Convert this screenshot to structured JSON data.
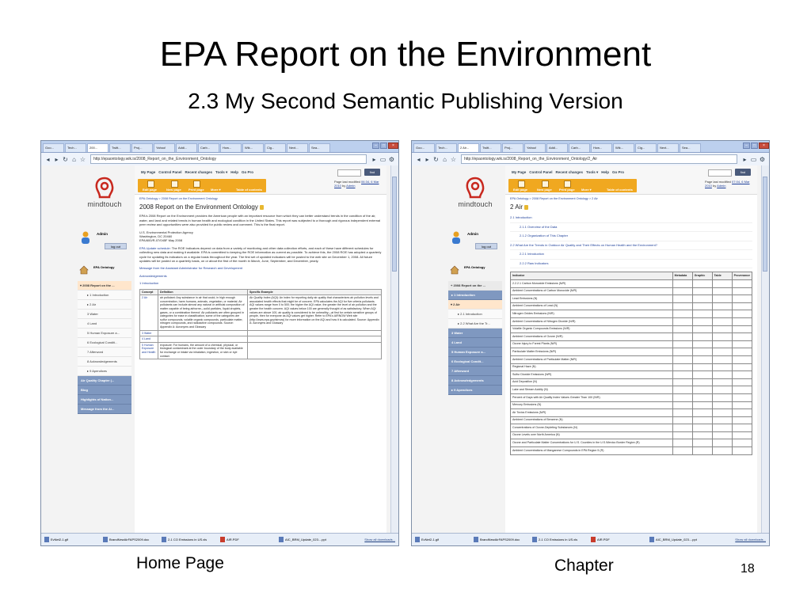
{
  "slide": {
    "title": "EPA Report on the Environment",
    "subtitle": "2.3 My Second Semantic Publishing Version",
    "caption_left": "Home Page",
    "caption_right": "Chapter",
    "page_number": "18"
  },
  "left_browser": {
    "tabs": [
      "Goo...",
      "Tech...",
      "200...",
      "Twitt...",
      "Proj...",
      "Yahoo!",
      "Addi...",
      "Carb...",
      "How...",
      "Wik...",
      "Cig...",
      "Next...",
      "Sea..."
    ],
    "active_tab": 2,
    "url": "http://epaontology.wik.is/2008_Report_on_the_Environment_Ontology",
    "window_buttons": [
      "–",
      "□",
      "×"
    ],
    "logo_text": "mindtouch",
    "user": "Admin",
    "logout": "log out",
    "nav_header": "EPA Ontology",
    "nav": [
      {
        "label": "▾ 2008 Report on the ...",
        "kind": "current"
      },
      {
        "label": "▸ 1 Introduction",
        "kind": "sub"
      },
      {
        "label": "▸ 2 Air",
        "kind": "sub"
      },
      {
        "label": "3 Water",
        "kind": "sub"
      },
      {
        "label": "4 Land",
        "kind": "sub"
      },
      {
        "label": "5 Human Exposure a...",
        "kind": "sub"
      },
      {
        "label": "6 Ecological Conditi...",
        "kind": "sub"
      },
      {
        "label": "7 Afterword",
        "kind": "sub"
      },
      {
        "label": "8 Acknowledgements",
        "kind": "sub"
      },
      {
        "label": "▸ 9 Apendices",
        "kind": "sub"
      },
      {
        "label": "Air Quality Chapter (...",
        "kind": "dark"
      },
      {
        "label": "Blog",
        "kind": "dark"
      },
      {
        "label": "Highlights of Nation...",
        "kind": "dark"
      },
      {
        "label": "Message from the Ai...",
        "kind": "dark"
      }
    ],
    "toplinks": [
      "My Page",
      "Control Panel",
      "Recent changes",
      "Tools ▾",
      "Help",
      "Go Pro"
    ],
    "find": "find",
    "editbar": [
      "Edit page",
      "New page",
      "Print page",
      "More ▾",
      "Table of contents"
    ],
    "lastmod_prefix": "Page last modified",
    "lastmod_date": "06:34, 6 Mar 2010",
    "lastmod_by": "by",
    "lastmod_user": "Admin",
    "breadcrumb": "EPA Ontology > 2008 Report on the Environment Ontology",
    "page_title": "2008 Report on the Environment Ontology",
    "intro": "EPA's 2008 Report on the Environment provides the American people with an important resource from which they can better understand trends in the condition of the air, water, and land and related trends in human health and ecological condition in the United States. This report was subjected to a thorough and rigorous independent external peer review and opportunities were also provided for public review and comment. This is the final report.",
    "address": "U.S. Environmental Protection Agency",
    "address2": "Washington, DC 20460",
    "address3": "EPA/600/R-07/045F May 2008",
    "update_link": "EPA Update schedule",
    "update_text": ": The ROE Indicators depend on data from a variety of monitoring and other data collection efforts, and each of these have different schedules for collecting new data and making it available. EPA is committed to keeping the ROE information as current as possible. To achieve this, the 2008 ROE has adopted a quarterly cycle for updating its indicators on a regular basis throughout the year. The first set of updated indicators will be posted to the web site on December 1, 2008. All future updates will be posted on a quarterly basis, on or about the first of the month in March, June, September, and December, yearly.",
    "msg_link": "Message from the Assistant Administrator for Research and Development",
    "ack_link": "Acknowledgements",
    "intro_link": "1 Introduction",
    "table_headers": [
      "Concept",
      "Definition",
      "Specific Example"
    ],
    "table_rows": [
      {
        "concept": "2 Air",
        "definition": "air pollutant: Any substance in air that could, in high enough concentration, harm humans, animals, vegetation, or material. Air pollutants can include almost any natural or artificial composition of matter capable of being airborne—solid particles, liquid droplets, gases, or a combination thereof. Air pollutants are often grouped in categories for ease in classification; some of the categories are sulfur compounds, volatile organic compounds, particulate matter, nitrogen compounds, and radioactive compounds. Source: Appendix A: Acronyms and Glossary",
        "example": "Air Quality Index (AQI): An index for reporting daily air quality that characterizes air pollution levels and associated health effects that might be of concern. EPA calculates the AQI for five criteria pollutants. AQI values range from 0 to 500; the higher the AQI value, the greater the level of air pollution and the greater the health concern. AQI values below 100 are generally thought of as satisfactory. When AQI values are above 100, air quality is considered to be unhealthy—at first for certain sensitive groups of people, then for everyone as AQI values get higher. Refer to EPA's AIRNOW Web site (http://www.epa.gov/airnow) for more information on the AQI and how it is calculated. Source: Appendix A: Acronyms and Glossary"
      },
      {
        "concept": "3 Water",
        "definition": "",
        "example": ""
      },
      {
        "concept": "4 Land",
        "definition": "",
        "example": ""
      },
      {
        "concept": "5 Human Exposure and Health",
        "definition": "exposure: For humans, the amount of a chemical, physical, or biological contaminant at the outer boundary of the body available for exchange or intake via inhalation, ingestion, or skin or eye contact.",
        "example": ""
      }
    ],
    "downloads": [
      {
        "name": "EvNet2-1.gif",
        "kind": "img"
      },
      {
        "name": "BrandNewAirFAPS2009.doc",
        "kind": "doc"
      },
      {
        "name": "2-1 CO Emissions in US.xls",
        "kind": "doc"
      },
      {
        "name": "AIR.PDF",
        "kind": "pdf"
      },
      {
        "name": "AIC_BRM_Update_023....ppt",
        "kind": "doc"
      }
    ],
    "show_all": "Show all downloads..."
  },
  "right_browser": {
    "tabs": [
      "Goo...",
      "Tech...",
      "2 Air...",
      "Twitt...",
      "Proj...",
      "Yahoo!",
      "Addi...",
      "Carb...",
      "How...",
      "Wik...",
      "Cig...",
      "Next...",
      "Sea..."
    ],
    "active_tab": 2,
    "url": "http://epaontology.wik.is/2008_Report_on_the_Environment_Ontology/2_Air",
    "window_buttons": [
      "–",
      "□",
      "×"
    ],
    "logo_text": "mindtouch",
    "user": "Admin",
    "logout": "log out",
    "nav_header": "EPA Ontology",
    "nav": [
      {
        "label": "+ 2008 Report on the ...",
        "kind": "top"
      },
      {
        "label": "▸ 1 Introduction",
        "kind": "dark"
      },
      {
        "label": "▾ 2 Air",
        "kind": "current"
      },
      {
        "label": "▸ 2.1 Introduction",
        "kind": "sub"
      },
      {
        "label": "▸ 2.2 What Are the Tr...",
        "kind": "sub"
      },
      {
        "label": "3 Water",
        "kind": "dark"
      },
      {
        "label": "4 Land",
        "kind": "dark"
      },
      {
        "label": "5 Human Exposure a...",
        "kind": "dark"
      },
      {
        "label": "6 Ecological Condit...",
        "kind": "dark"
      },
      {
        "label": "7 Afterword",
        "kind": "dark"
      },
      {
        "label": "8 Acknowledgements",
        "kind": "dark"
      },
      {
        "label": "▸ 9 Apendices",
        "kind": "dark"
      }
    ],
    "toplinks": [
      "My Page",
      "Control Panel",
      "Recent changes",
      "Tools ▾",
      "Help",
      "Go Pro"
    ],
    "find": "find",
    "editbar": [
      "Edit page",
      "New page",
      "Print page",
      "More ▾",
      "Table of contents"
    ],
    "lastmod_prefix": "Page last modified",
    "lastmod_date": "07:04, 6 Mar 2010",
    "lastmod_by": "by",
    "lastmod_user": "Admin",
    "breadcrumb": "EPA Ontology > 2008 Report on the Environment Ontology > 2 Air",
    "page_title": "2 Air",
    "toc": [
      {
        "label": "2.1 Introduction",
        "level": 1
      },
      {
        "label": "2.1.1 Overview of the Data",
        "level": 2
      },
      {
        "label": "2.1.2 Organization of This Chapter",
        "level": 2
      },
      {
        "label": "2.2 What Are the Trends in Outdoor Air Quality and Their Effects on Human Health and the Environment?",
        "level": 1
      },
      {
        "label": "2.2.1 Introduction",
        "level": 2
      },
      {
        "label": "2.2.2 Raw Indicators",
        "level": 2
      }
    ],
    "table_headers": [
      "Indicator",
      "Metadata",
      "Graphic",
      "Table",
      "Provenance"
    ],
    "indicators": [
      "2.2.2.1 Carbon Monoxide Emissions (N/R)",
      "Ambient Concentrations of Carbon Monoxide (N/R)",
      "Lead Emissions (N)",
      "Ambient Concentrations of Lead (N)",
      "Nitrogen Oxides Emissions (N/R)",
      "Ambient Concentrations of Nitrogen Dioxide (N/R)",
      "Volatile Organic Compounds Emissions (N/R)",
      "Ambient Concentrations of Ozone (N/R)",
      "Ozone Injury to Forest Plants (N/R)",
      "Particulate Matter Emissions (N/R)",
      "Ambient Concentrations of Particulate Matter (N/R)",
      "Regional Haze (N)",
      "Sulfur Dioxide Emissions (N/R)",
      "Acid Deposition (N)",
      "Lake and Stream Acidity (N)",
      "Percent of Days with Air Quality Index Values Greater Than 100 (N/R)",
      "Mercury Emissions (N)",
      "Air Toxics Emissions (N/R)",
      "Ambient Concentrations of Benzene (N)",
      "Concentrations of Ozone-Depleting Substances (N)",
      "Ozone Levels over North America (N)",
      "Ozone and Particulate Matter Concentrations for U.S. Counties in the U.S./Mexico Border Region (R)",
      "Ambient Concentrations of Manganese Compounds in EPA Region 5 (R)"
    ],
    "downloads": [
      {
        "name": "EvNet2-1.gif",
        "kind": "img"
      },
      {
        "name": "BrandNewAirFAPS2009.doc",
        "kind": "doc"
      },
      {
        "name": "2-1 CO Emissions in US.xls",
        "kind": "doc"
      },
      {
        "name": "AIR.PDF",
        "kind": "pdf"
      },
      {
        "name": "AIC_BRM_Update_023....ppt",
        "kind": "doc"
      }
    ],
    "show_all": "Show all downloads..."
  }
}
